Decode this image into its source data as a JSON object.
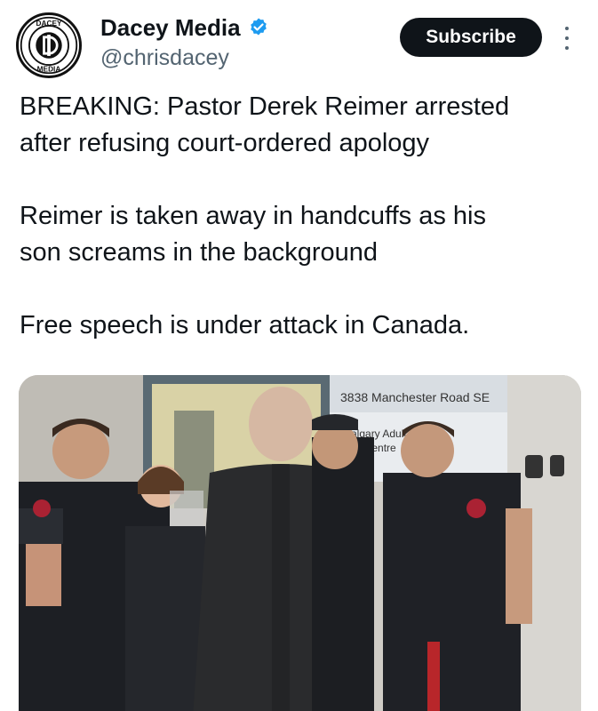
{
  "account": {
    "display_name": "Dacey Media",
    "handle": "@chrisdacey",
    "verified": true,
    "avatar_top_text": "DACEY",
    "avatar_bottom_text": "MEDIA"
  },
  "actions": {
    "subscribe_label": "Subscribe",
    "more_icon": "more-vertical-icon",
    "verified_icon": "verified-badge-icon"
  },
  "tweet": {
    "paragraphs": [
      [
        "BREAKING: Pastor Derek Reimer arrested",
        "after refusing court-ordered apology"
      ],
      [
        "Reimer is taken away in handcuffs as his",
        "son screams in the background"
      ],
      [
        "Free speech is under attack in Canada."
      ]
    ]
  },
  "media": {
    "sign_address": "3838 Manchester Road SE",
    "sign_line_1": "algary Adult",
    "sign_line_2": "tten        entre"
  },
  "colors": {
    "primary_text": "#0f1419",
    "secondary_text": "#536471",
    "verified_blue": "#1d9bf0",
    "button_bg": "#0f1419"
  }
}
